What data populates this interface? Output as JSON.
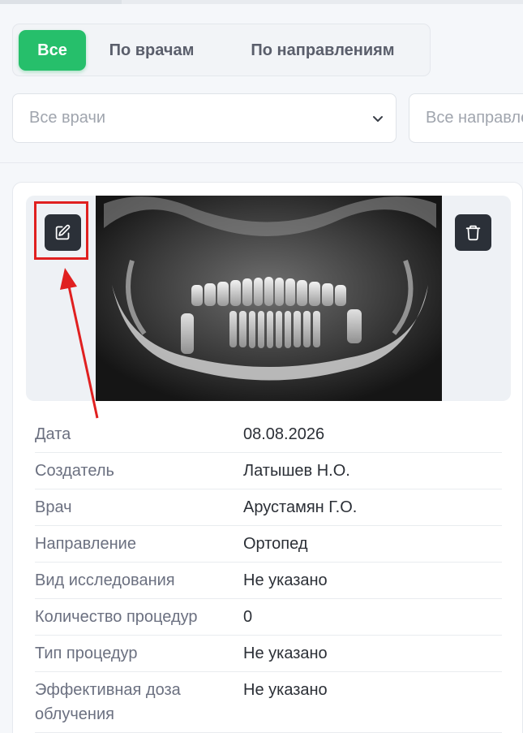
{
  "tabs": [
    {
      "label": "Все",
      "active": true
    },
    {
      "label": "По врачам",
      "active": false
    },
    {
      "label": "По направлениям",
      "active": false
    }
  ],
  "filters": {
    "doctor_select": "Все врачи",
    "direction_select": "Все направления"
  },
  "card": {
    "fields": [
      {
        "label": "Дата",
        "value": "08.08.2026"
      },
      {
        "label": "Создатель",
        "value": "Латышев Н.О."
      },
      {
        "label": "Врач",
        "value": "Арустамян Г.О."
      },
      {
        "label": "Направление",
        "value": "Ортопед"
      },
      {
        "label": "Вид исследования",
        "value": "Не указано"
      },
      {
        "label": "Количество процедур",
        "value": "0"
      },
      {
        "label": "Тип процедур",
        "value": "Не указано"
      },
      {
        "label": "Эффективная доза облучения",
        "value": "Не указано"
      }
    ]
  },
  "icons": {
    "edit": "edit-icon",
    "delete": "trash-icon",
    "chevron": "chevron-down-icon"
  },
  "colors": {
    "accent": "#26bf6b",
    "icon_button": "#2b3038",
    "annotation": "#e02020"
  }
}
